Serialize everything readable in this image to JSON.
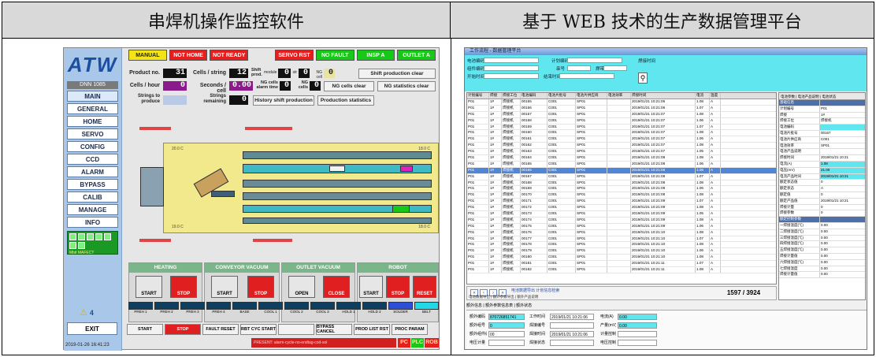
{
  "headers": {
    "left": "串焊机操作监控软件",
    "right": "基于 WEB 技术的生产数据管理平台"
  },
  "left": {
    "logo": "ATW",
    "version": "DNN 1085",
    "nav": [
      "MAIN",
      "GENERAL",
      "HOME",
      "SERVO",
      "CONFIG",
      "CCD",
      "ALARM",
      "BYPASS",
      "CALIB",
      "MANAGE",
      "INFO"
    ],
    "led_text": "Mbit MAFECT",
    "alarm_count": "4",
    "exit": "EXIT",
    "datetime": "2019-01-26 16:41:23",
    "status": [
      {
        "label": "MANUAL",
        "color": "#f2e418"
      },
      {
        "label": "NOT HOME",
        "color": "#e61e1e"
      },
      {
        "label": "NOT READY",
        "color": "#e61e1e"
      },
      {
        "label": "SERVO RST",
        "color": "#e61e1e"
      },
      {
        "label": "NO FAULT",
        "color": "#18c818"
      },
      {
        "label": "INSP A",
        "color": "#18c818"
      },
      {
        "label": "OUTLET A",
        "color": "#18c818"
      }
    ],
    "info": {
      "product_no_label": "Product no.",
      "product_no": "31",
      "cells_string_label": "Cells / string",
      "cells_string": "12",
      "shift_prod_label": "Shift prod.",
      "module_label": "module",
      "module": "0",
      "str_label": "str",
      "str": "0",
      "cell_label": "NG cell",
      "cell": "0",
      "cells_hour_label": "Cells / hour",
      "cells_hour": "0",
      "seconds_cell_label": "Seconds / cell",
      "seconds_cell": "0.00",
      "ng_alarm_label": "NG cells alarm time",
      "ng_alarm": "0",
      "ng_cells_label": "NG cells",
      "ng_cells": "0",
      "strings_produce_label": "Strings to produce",
      "strings_produce": "",
      "strings_remaining_label": "Strings remaining",
      "strings_remaining": "0"
    },
    "buttons": {
      "shift_clear": "Shift production clear",
      "ng_clear": "NG cells clear",
      "ng_stats_clear": "NG statistics clear",
      "history": "History shift production",
      "prod_stats": "Production statistics"
    },
    "machine": {
      "temp_tl": "20.0 C",
      "temp_tr": "18.0 C",
      "temp_bl": "19.0 C",
      "temp_br": "18.0 C"
    },
    "groups": [
      {
        "title": "HEATING",
        "left": "START",
        "right": "STOP"
      },
      {
        "title": "CONVEYOR VACUUM",
        "left": "START",
        "right": "STOP"
      },
      {
        "title": "OUTLET VACUUM",
        "left": "OPEN",
        "right": "CLOSE"
      },
      {
        "title": "ROBOT",
        "left": "START",
        "right": "STOP",
        "third": "RESET"
      }
    ],
    "readouts": [
      "PREH 1",
      "PREH 2",
      "PREH 3",
      "PREH 4",
      "BASE",
      "COOL 1",
      "COOL 2",
      "COOL 3",
      "HOLD 1",
      "HOLD 2",
      "SOLDER",
      "BELT"
    ],
    "bottom_buttons": [
      "START",
      "STOP",
      "FAULT RESET",
      "RBT CYC START",
      "",
      "BYPASS CANCEL",
      "PROD LIST RST",
      "PROC PARAM"
    ],
    "alarm_msg": "PRESENT: alarm-cycle-no-endtag-cod-sol",
    "plc": [
      "PC",
      "PLC",
      "ROB"
    ]
  },
  "right": {
    "title": "工作流程 - 数据管理平台",
    "filters": [
      "电池编码",
      "计划编码",
      "焊接时间",
      "组件编码",
      "串号",
      "焊带",
      "开始时间",
      "结束时间"
    ],
    "columns": [
      "计划编号",
      "焊接",
      "焊接工位",
      "电池编码",
      "电池片批号",
      "电池片供应商",
      "电池效率",
      "焊接时间",
      "电流",
      "温度"
    ],
    "rows": [
      [
        "P01",
        "1#",
        "焊接机",
        "00155",
        "C001",
        "SP01",
        "2019/01/21 10:21:06",
        "1.08",
        "A"
      ],
      [
        "P01",
        "1#",
        "焊接机",
        "00156",
        "C001",
        "SP01",
        "2019/01/21 10:21:06",
        "1.07",
        "A"
      ],
      [
        "P01",
        "1#",
        "焊接机",
        "00157",
        "C001",
        "SP01",
        "2019/01/21 10:21:07",
        "1.08",
        "A"
      ],
      [
        "P01",
        "1#",
        "焊接机",
        "00158",
        "C001",
        "SP01",
        "2019/01/21 10:21:07",
        "1.06",
        "A"
      ],
      [
        "P01",
        "1#",
        "焊接机",
        "00159",
        "C001",
        "SP01",
        "2019/01/21 10:21:07",
        "1.07",
        "A"
      ],
      [
        "P01",
        "1#",
        "焊接机",
        "00160",
        "C001",
        "SP01",
        "2019/01/21 10:21:07",
        "1.08",
        "A"
      ],
      [
        "P01",
        "1#",
        "焊接机",
        "00161",
        "C001",
        "SP01",
        "2019/01/21 10:21:07",
        "1.06",
        "A"
      ],
      [
        "P01",
        "1#",
        "焊接机",
        "00162",
        "C001",
        "SP01",
        "2019/01/21 10:21:07",
        "1.08",
        "A"
      ],
      [
        "P01",
        "1#",
        "焊接机",
        "00163",
        "C001",
        "SP01",
        "2019/01/21 10:21:07",
        "1.05",
        "A"
      ],
      [
        "P01",
        "1#",
        "焊接机",
        "00164",
        "C001",
        "SP01",
        "2019/01/21 10:21:08",
        "1.08",
        "A"
      ],
      [
        "P01",
        "1#",
        "焊接机",
        "00165",
        "C001",
        "SP01",
        "2019/01/21 10:21:08",
        "1.06",
        "A"
      ],
      [
        "P01",
        "1#",
        "焊接机",
        "00166",
        "C001",
        "SP01",
        "2019/01/21 10:21:08",
        "1.08",
        "A"
      ],
      [
        "P01",
        "1#",
        "焊接机",
        "00167",
        "C001",
        "SP01",
        "2019/01/21 10:21:08",
        "1.07",
        "A"
      ],
      [
        "P01",
        "1#",
        "焊接机",
        "00168",
        "C001",
        "SP01",
        "2019/01/21 10:21:08",
        "1.08",
        "A"
      ],
      [
        "P01",
        "1#",
        "焊接机",
        "00169",
        "C001",
        "SP01",
        "2019/01/21 10:21:08",
        "1.06",
        "A"
      ],
      [
        "P01",
        "1#",
        "焊接机",
        "00170",
        "C001",
        "SP01",
        "2019/01/21 10:21:08",
        "1.08",
        "A"
      ],
      [
        "P01",
        "1#",
        "焊接机",
        "00171",
        "C001",
        "SP01",
        "2019/01/21 10:21:09",
        "1.07",
        "A"
      ],
      [
        "P01",
        "1#",
        "焊接机",
        "00172",
        "C001",
        "SP01",
        "2019/01/21 10:21:09",
        "1.08",
        "A"
      ],
      [
        "P01",
        "1#",
        "焊接机",
        "00173",
        "C001",
        "SP01",
        "2019/01/21 10:21:09",
        "1.05",
        "A"
      ],
      [
        "P01",
        "1#",
        "焊接机",
        "00174",
        "C001",
        "SP01",
        "2019/01/21 10:21:09",
        "1.08",
        "A"
      ],
      [
        "P01",
        "1#",
        "焊接机",
        "00175",
        "C001",
        "SP01",
        "2019/01/21 10:21:09",
        "1.06",
        "A"
      ],
      [
        "P01",
        "1#",
        "焊接机",
        "00176",
        "C001",
        "SP01",
        "2019/01/21 10:21:10",
        "1.08",
        "A"
      ],
      [
        "P01",
        "1#",
        "焊接机",
        "00177",
        "C001",
        "SP01",
        "2019/01/21 10:21:10",
        "1.07",
        "A"
      ],
      [
        "P01",
        "1#",
        "焊接机",
        "00178",
        "C001",
        "SP01",
        "2019/01/21 10:21:10",
        "1.08",
        "A"
      ],
      [
        "P01",
        "1#",
        "焊接机",
        "00179",
        "C001",
        "SP01",
        "2019/01/21 10:21:10",
        "1.06",
        "A"
      ],
      [
        "P01",
        "1#",
        "焊接机",
        "00180",
        "C001",
        "SP01",
        "2019/01/21 10:21:10",
        "1.08",
        "A"
      ],
      [
        "P01",
        "1#",
        "焊接机",
        "00181",
        "C001",
        "SP01",
        "2019/01/21 10:21:11",
        "1.07",
        "A"
      ],
      [
        "P01",
        "1#",
        "焊接机",
        "00182",
        "C001",
        "SP01",
        "2019/01/21 10:21:11",
        "1.08",
        "A"
      ]
    ],
    "prop_tabs": "电池参数 | 电池产品说明 | 电池状态",
    "props": [
      {
        "k": "基础信息",
        "v": "",
        "hd": true
      },
      {
        "k": "计划编号",
        "v": "P01"
      },
      {
        "k": "焊接",
        "v": "1#"
      },
      {
        "k": "焊接工位",
        "v": "焊接机"
      },
      {
        "k": "电池编码",
        "v": "",
        "hl": true
      },
      {
        "k": "电池片批号",
        "v": "00167"
      },
      {
        "k": "电池片供应商",
        "v": "C001"
      },
      {
        "k": "电池效率",
        "v": "SP01"
      },
      {
        "k": "电池产品说明",
        "v": ""
      },
      {
        "k": "焊接时间",
        "v": "2019/01/21 10:21"
      },
      {
        "k": "电流(A)",
        "v": "1.08",
        "hl": true
      },
      {
        "k": "电压(mV)",
        "v": "21.00",
        "hl": true
      },
      {
        "k": "电流产品时间",
        "v": "2019/01/21 10:21",
        "hl": true
      },
      {
        "k": "额定状态值",
        "v": "0"
      },
      {
        "k": "额定状态",
        "v": "A"
      },
      {
        "k": "额定值",
        "v": "0"
      },
      {
        "k": "额定产品值",
        "v": "2019/01/21 10:21"
      },
      {
        "k": "焊接计量",
        "v": "0"
      },
      {
        "k": "焊接参数",
        "v": "0"
      },
      {
        "k": "额定控制参数",
        "v": "",
        "hd": true
      },
      {
        "k": "一焊接温度(℃)",
        "v": "0.00"
      },
      {
        "k": "二焊接温度(℃)",
        "v": "0.00"
      },
      {
        "k": "三焊接温度(℃)",
        "v": "0.00"
      },
      {
        "k": "四焊接温度(℃)",
        "v": "0.00"
      },
      {
        "k": "五焊接温度(℃)",
        "v": "0.00"
      },
      {
        "k": "焊接计量值",
        "v": "0.00"
      },
      {
        "k": "六焊接温度(℃)",
        "v": "0.00"
      },
      {
        "k": "七焊接温度",
        "v": "0.00"
      },
      {
        "k": "焊接计量值",
        "v": "0.00"
      }
    ],
    "pager_links": "电池数据导出  计划信息检索",
    "pager_tabs": "电池数据导出 | 额外参数导出 | 额外产品说明",
    "count": "1597 / 3924",
    "bottom_tabs": "额外信息 | 额外参数信息表 | 额外状态",
    "detail": [
      {
        "k": "额外编码",
        "v": "870726851741",
        "k2": "工作时间",
        "v2": "2019/01/21 10:21:06",
        "k3": "电流(A)",
        "v3": "0.00"
      },
      {
        "k": "额外组号",
        "v": "0",
        "k2": "焊接编号",
        "v2": "",
        "k3": "产量(mV)",
        "v3": "0.00"
      },
      {
        "k": "额外组件编号",
        "v": "00",
        "k2": "焊接时间",
        "v2": "2019/01/21 10:21:06",
        "k3": "计量控制",
        "v3": ""
      },
      {
        "k": "电压计量",
        "v": "",
        "k2": "焊接状态",
        "v2": "",
        "k3": "电压控制参数",
        "v3": ""
      }
    ]
  }
}
